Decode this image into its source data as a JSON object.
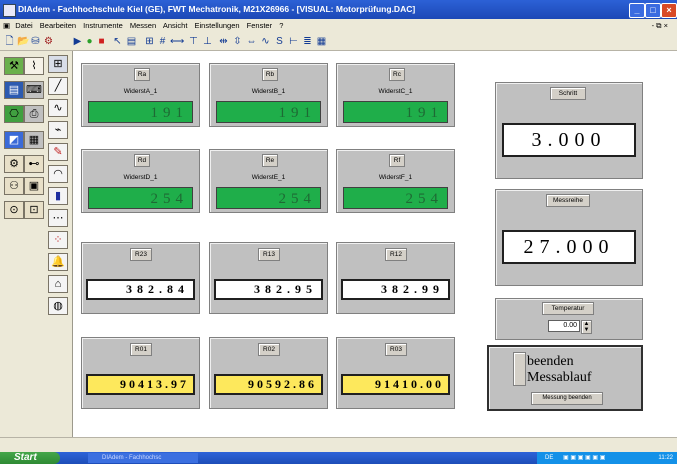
{
  "window": {
    "title": "DIAdem - Fachhochschule Kiel   (GE), FWT Mechatronik, M21X26966 - [VISUAL:  Motorprüfung.DAC]",
    "minimize": "_",
    "maximize": "□",
    "close": "×",
    "mdi_controls": "- ⧉ ×"
  },
  "menu": [
    "Datei",
    "Bearbeiten",
    "Instrumente",
    "Messen",
    "Ansicht",
    "Einstellungen",
    "Fenster",
    "?"
  ],
  "resistance_panels": [
    {
      "button": "Ra",
      "label": "WiderstA_1",
      "value": "191"
    },
    {
      "button": "Rb",
      "label": "WiderstB_1",
      "value": "191"
    },
    {
      "button": "Rc",
      "label": "WiderstC_1",
      "value": "191"
    },
    {
      "button": "Rd",
      "label": "WiderstD_1",
      "value": "254"
    },
    {
      "button": "Re",
      "label": "WiderstE_1",
      "value": "254"
    },
    {
      "button": "Rf",
      "label": "WiderstF_1",
      "value": "254"
    }
  ],
  "line_panels": [
    {
      "button": "R23",
      "value": "382.84"
    },
    {
      "button": "R13",
      "value": "382.95"
    },
    {
      "button": "R12",
      "value": "382.99"
    }
  ],
  "zero_panels": [
    {
      "button": "R01",
      "value": "90413.97"
    },
    {
      "button": "R02",
      "value": "90592.86"
    },
    {
      "button": "R03",
      "value": "91410.00"
    }
  ],
  "schritt": {
    "button": "Schritt",
    "value": "3.000"
  },
  "messreihe": {
    "button": "Messreihe",
    "value": "27.000"
  },
  "temperatur": {
    "button": "Temperatur",
    "value": "0.00"
  },
  "beenden": {
    "line1": "beenden",
    "line2": "Messablauf",
    "button": "Messung beenden"
  },
  "taskbar": {
    "start": "Start",
    "task": "DIAdem - Fachhochsc",
    "lang": "DE",
    "clock": "11:22"
  }
}
